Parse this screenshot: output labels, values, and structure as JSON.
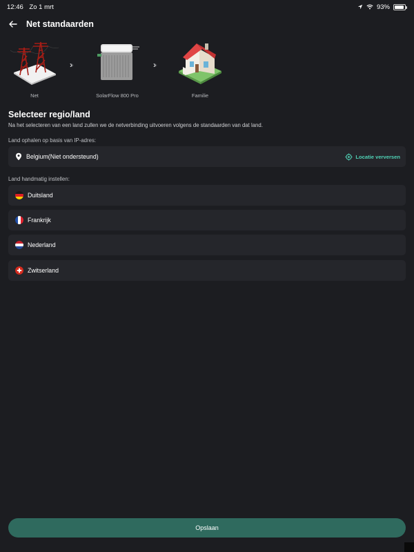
{
  "status_bar": {
    "time": "12:46",
    "date": "Zo 1 mrt",
    "battery": "93%",
    "battery_level": 0.93
  },
  "header": {
    "title": "Net standaarden"
  },
  "flow": {
    "items": [
      {
        "label": "Net",
        "icon": "power-tower-icon"
      },
      {
        "label": "SolarFlow 800 Pro",
        "icon": "solarflow-device-icon"
      },
      {
        "label": "Familie",
        "icon": "house-icon"
      }
    ]
  },
  "region": {
    "title": "Selecteer regio/land",
    "description": "Na het selecteren van een land zullen we de netverbinding uitvoeren volgens de standaarden van dat land.",
    "ip_label": "Land ophalen op basis van IP-adres:",
    "ip_country": "Belgium(Niet ondersteund)",
    "refresh_label": "Locatie verversen",
    "manual_label": "Land handmatig instellen:",
    "countries": [
      {
        "name": "Duitsland",
        "flag": "germany-flag"
      },
      {
        "name": "Frankrijk",
        "flag": "france-flag"
      },
      {
        "name": "Nederland",
        "flag": "netherlands-flag"
      },
      {
        "name": "Zwitserland",
        "flag": "switzerland-flag"
      }
    ]
  },
  "footer": {
    "save_label": "Opslaan"
  },
  "colors": {
    "background": "#1c1d21",
    "card": "#25262b",
    "accent": "#4fd1b5",
    "button": "#2f6a5e"
  }
}
